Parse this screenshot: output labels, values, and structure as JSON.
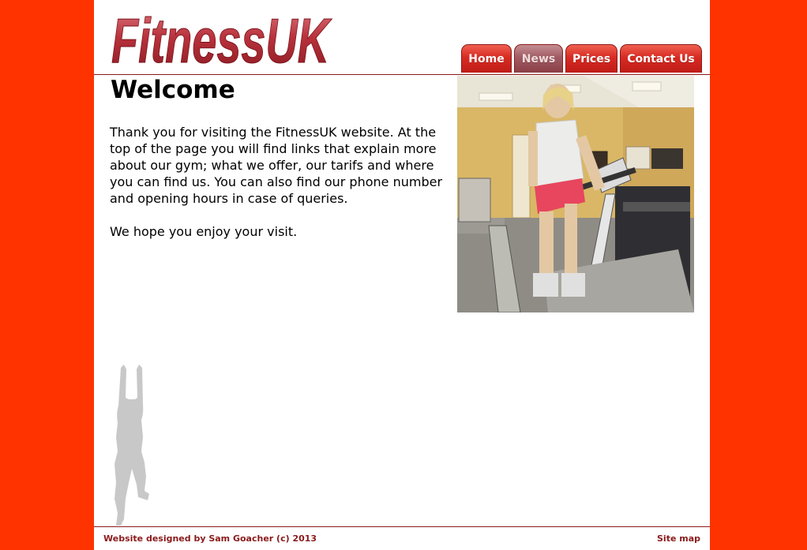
{
  "header": {
    "logo_text": "FitnessUK"
  },
  "nav": {
    "items": [
      {
        "label": "Home",
        "active": false
      },
      {
        "label": "News",
        "active": true
      },
      {
        "label": "Prices",
        "active": false
      },
      {
        "label": "Contact Us",
        "active": false
      }
    ]
  },
  "main": {
    "title": "Welcome",
    "paragraphs": [
      "Thank you for visiting the FitnessUK website. At the top of the page you will find links that explain more about our gym; what we offer, our tarifs and where you can find us. You can also find our phone number and opening hours in case of queries.",
      "We hope you enjoy your visit."
    ]
  },
  "footer": {
    "credit": "Website designed by Sam Goacher (c) 2013",
    "sitemap": "Site map"
  },
  "colors": {
    "page_background": "#ff3300",
    "content_background": "#ffffff",
    "accent": "#8b1a1a",
    "tab_red": "#d72b22",
    "tab_active": "#a05b62"
  }
}
